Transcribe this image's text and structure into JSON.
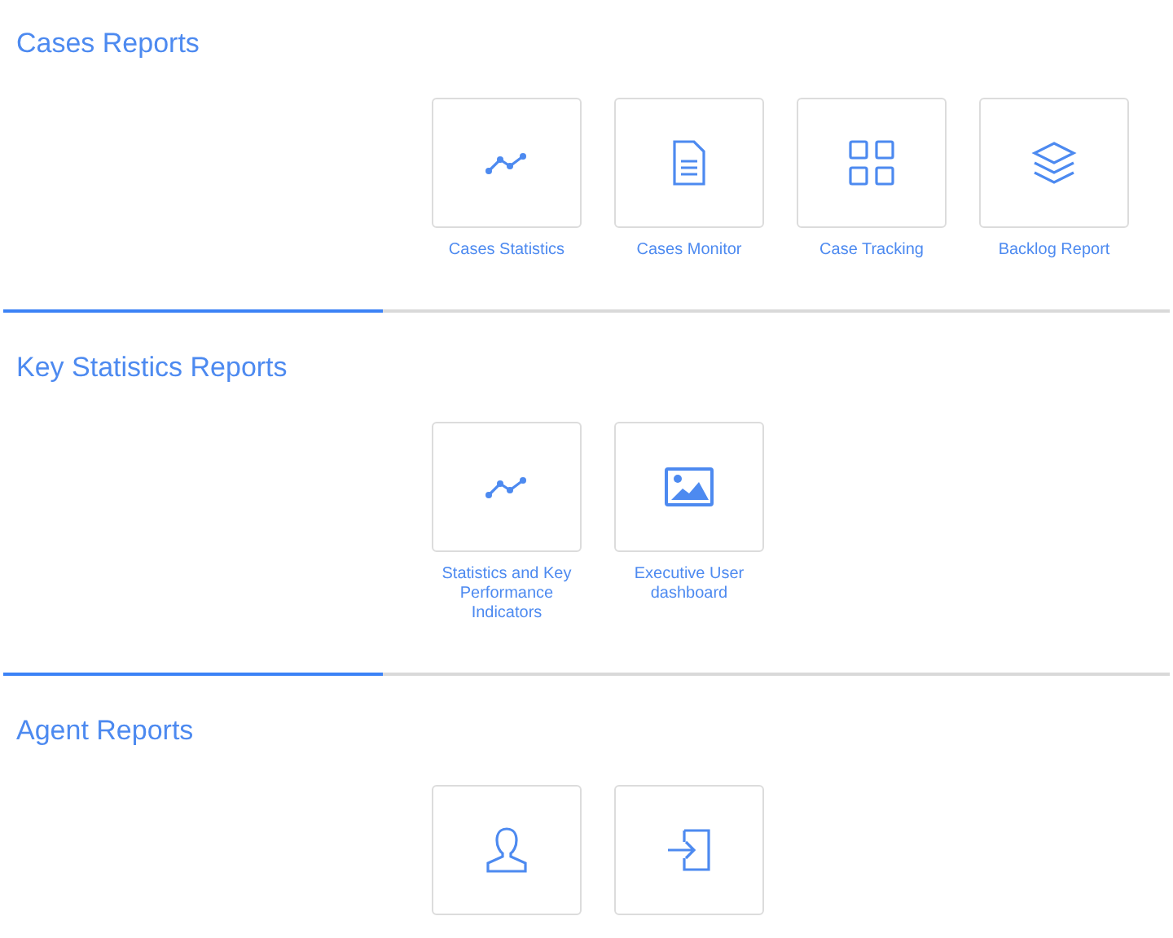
{
  "sections": [
    {
      "title": "Cases Reports",
      "reports": [
        {
          "label": "Cases Statistics",
          "kind": "chart"
        },
        {
          "label": "Cases Monitor",
          "kind": "document"
        },
        {
          "label": "Case Tracking",
          "kind": "grid"
        },
        {
          "label": "Backlog Report",
          "kind": "layers"
        }
      ]
    },
    {
      "title": "Key Statistics Reports",
      "reports": [
        {
          "label": "Statistics and Key Performance Indicators",
          "kind": "chart"
        },
        {
          "label": "Executive User dashboard",
          "kind": "image"
        }
      ]
    },
    {
      "title": "Agent Reports",
      "reports": [
        {
          "kind": "user"
        },
        {
          "kind": "login"
        }
      ]
    }
  ]
}
